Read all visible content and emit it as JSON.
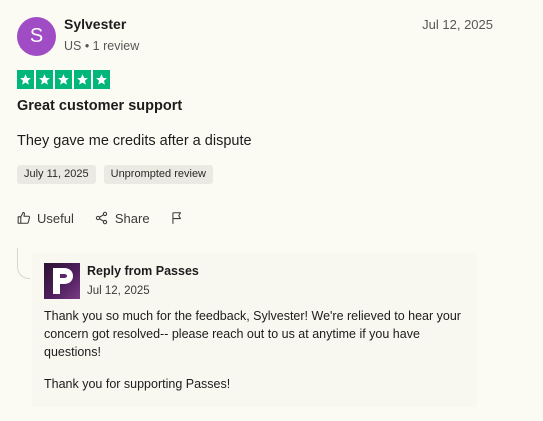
{
  "reviewer": {
    "initial": "S",
    "name": "Sylvester",
    "meta": "US • 1 review",
    "avatar_color": "#a04cc5"
  },
  "review": {
    "date": "Jul 12, 2025",
    "rating": 5,
    "star_color": "#00b67a",
    "title": "Great customer support",
    "body": "They gave me credits after a dispute",
    "tags": [
      "July 11, 2025",
      "Unprompted review"
    ]
  },
  "actions": {
    "useful_label": "Useful",
    "share_label": "Share",
    "useful_icon": "thumbs-up-icon",
    "share_icon": "share-icon",
    "flag_icon": "flag-icon"
  },
  "reply": {
    "from": "Reply from Passes",
    "date": "Jul 12, 2025",
    "message": "Thank you so much for the feedback, Sylvester! We're relieved to hear your concern got resolved-- please reach out to us at anytime if you have questions!",
    "thanks": "Thank you for supporting Passes!",
    "logo_icon": "passes-logo"
  }
}
